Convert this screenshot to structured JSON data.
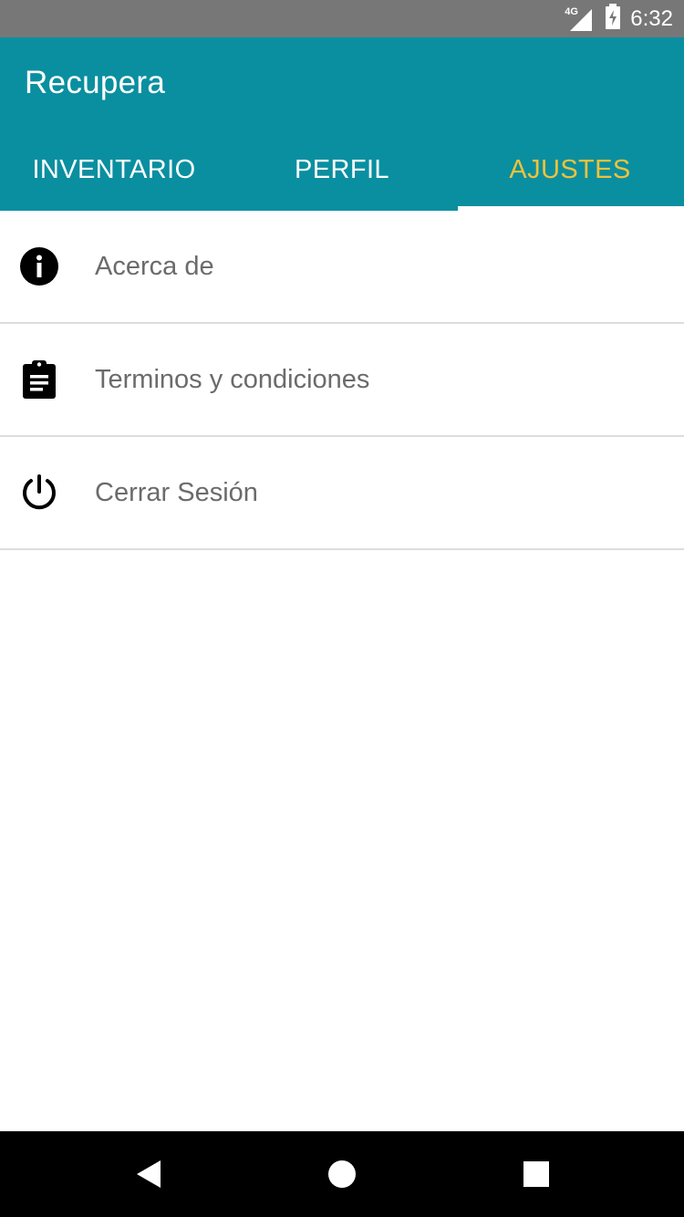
{
  "status_bar": {
    "network": "4G",
    "time": "6:32"
  },
  "app": {
    "title": "Recupera",
    "colors": {
      "primary": "#0a8fa0",
      "tab_active": "#f0c23a",
      "text_secondary": "#6b6b6b"
    }
  },
  "tabs": [
    {
      "label": "INVENTARIO",
      "active": false
    },
    {
      "label": "PERFIL",
      "active": false
    },
    {
      "label": "AJUSTES",
      "active": true
    }
  ],
  "settings": {
    "items": [
      {
        "label": "Acerca de",
        "icon": "info-icon"
      },
      {
        "label": "Terminos y condiciones",
        "icon": "clipboard-icon"
      },
      {
        "label": "Cerrar Sesión",
        "icon": "power-icon"
      }
    ]
  },
  "nav": {
    "buttons": [
      "back-icon",
      "home-icon",
      "recents-icon"
    ]
  }
}
